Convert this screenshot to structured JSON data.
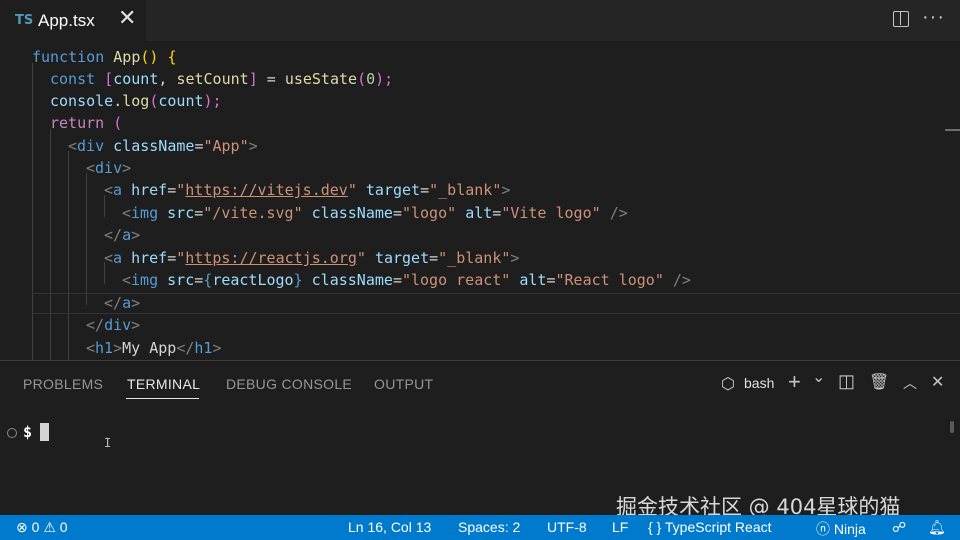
{
  "tab": {
    "lang": "TS",
    "title": "App.tsx",
    "close": "✕"
  },
  "header": {
    "more": "···"
  },
  "editor": {
    "l1": [
      "function",
      "App",
      "()",
      " {"
    ],
    "l2": [
      "const",
      "[",
      "count",
      ", ",
      "setCount",
      "]",
      " = ",
      "useState",
      "(",
      "0",
      ");"
    ],
    "l3": [
      "console",
      ".",
      "log",
      "(",
      "count",
      ");"
    ],
    "l4": [
      "return",
      "("
    ],
    "l5": [
      "<",
      "div",
      "className",
      "=",
      "\"App\"",
      ">"
    ],
    "l6": [
      "<",
      "div",
      ">"
    ],
    "l7": [
      "<",
      "a",
      "href",
      "=",
      "\"",
      "https://vitejs.dev",
      "\"",
      "target",
      "=",
      "\"_blank\"",
      ">"
    ],
    "l8": [
      "<",
      "img",
      "src",
      "=",
      "\"/vite.svg\"",
      "className",
      "=",
      "\"logo\"",
      "alt",
      "=",
      "\"Vite logo\"",
      "/>"
    ],
    "l9": [
      "</",
      "a",
      ">"
    ],
    "l10": [
      "<",
      "a",
      "href",
      "=",
      "\"",
      "https://reactjs.org",
      "\"",
      "target",
      "=",
      "\"_blank\"",
      ">"
    ],
    "l11": [
      "<",
      "img",
      "src",
      "=",
      "{",
      "reactLogo",
      "}",
      "className",
      "=",
      "\"logo react\"",
      "alt",
      "=",
      "\"React logo\"",
      "/>"
    ],
    "l12": [
      "</",
      "a",
      ">"
    ],
    "l13": [
      "</",
      "div",
      ">"
    ],
    "l14": [
      "<",
      "h1",
      ">",
      "My App",
      "</",
      "h1",
      ">"
    ]
  },
  "panel": {
    "tabs": [
      "PROBLEMS",
      "TERMINAL",
      "DEBUG CONSOLE",
      "OUTPUT"
    ],
    "terminal_name": "bash",
    "icons": {
      "add": "+",
      "dropdown": "⌄",
      "split": "◫",
      "trash": "🗑",
      "maximize": "︿",
      "close": "✕",
      "terminal": "⬡"
    },
    "prompt": "$"
  },
  "watermark": "掘金技术社区 @ 404星球的猫",
  "status": {
    "errors": "0",
    "warnings": "0",
    "position": "Ln 16, Col 13",
    "spaces": "Spaces: 2",
    "encoding": "UTF-8",
    "eol": "LF",
    "language_icon": "{ }",
    "language": "TypeScript React",
    "ninja": "Ninja"
  }
}
